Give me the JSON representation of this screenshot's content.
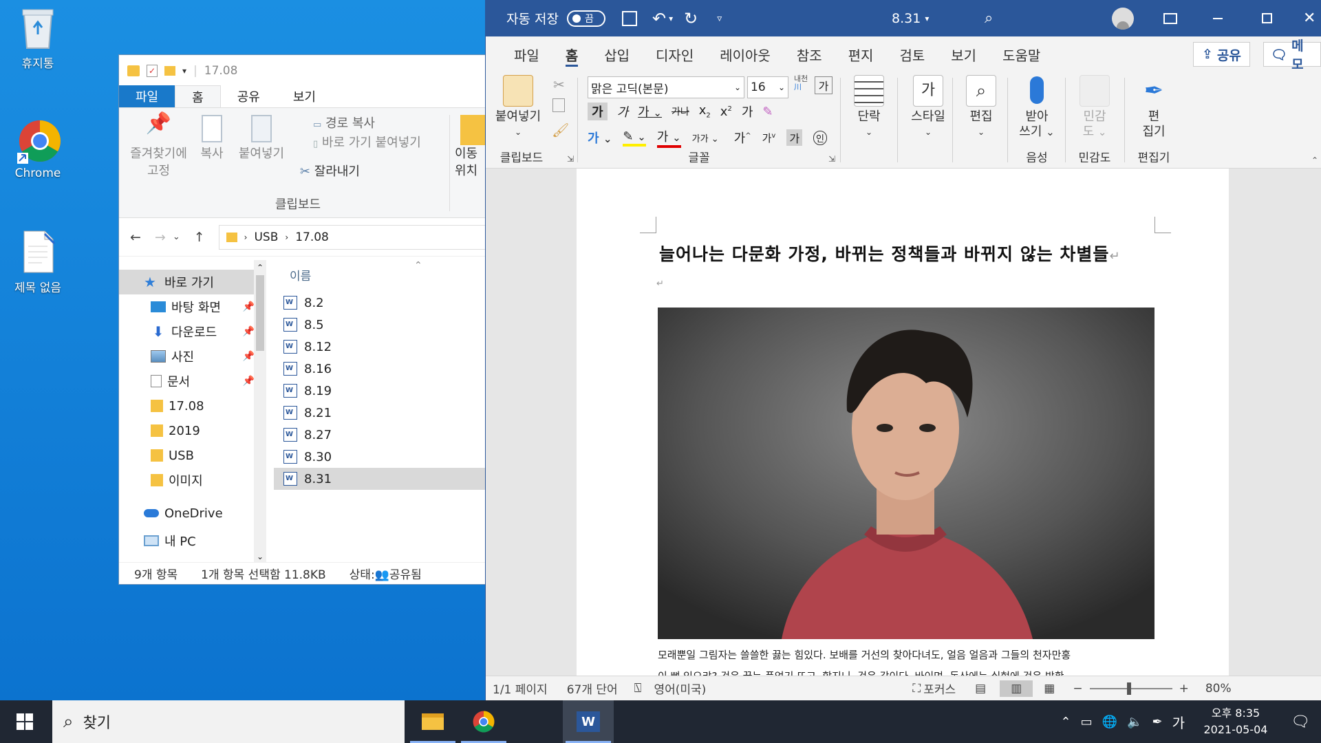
{
  "desktop": {
    "icons": [
      {
        "label": "휴지통",
        "icon": "recycle-bin-icon"
      },
      {
        "label": "Chrome",
        "icon": "chrome-icon"
      },
      {
        "label": "제목 없음",
        "icon": "document-icon"
      }
    ]
  },
  "explorer": {
    "title": "17.08",
    "tabs": [
      "파일",
      "홈",
      "공유",
      "보기"
    ],
    "ribbon": {
      "pin_label_1": "즐겨찾기에",
      "pin_label_2": "고정",
      "copy_label": "복사",
      "paste_label": "붙여넣기",
      "copy_path_label": "경로 복사",
      "paste_shortcut_label": "바로 가기 붙여넣기",
      "cut_label": "잘라내기",
      "group_label": "클립보드",
      "move_label_1": "이동",
      "move_label_2": "위치"
    },
    "address": {
      "parts": [
        "USB",
        "17.08"
      ]
    },
    "nav": [
      {
        "label": "바로 가기",
        "icon": "star-icon",
        "pinned": false
      },
      {
        "label": "바탕 화면",
        "icon": "desktop-icon",
        "pinned": true
      },
      {
        "label": "다운로드",
        "icon": "download-icon",
        "pinned": true
      },
      {
        "label": "사진",
        "icon": "pictures-icon",
        "pinned": true
      },
      {
        "label": "문서",
        "icon": "documents-icon",
        "pinned": true
      },
      {
        "label": "17.08",
        "icon": "folder-icon",
        "pinned": false
      },
      {
        "label": "2019",
        "icon": "folder-icon",
        "pinned": false
      },
      {
        "label": "USB",
        "icon": "folder-icon",
        "pinned": false
      },
      {
        "label": "이미지",
        "icon": "folder-icon",
        "pinned": false
      },
      {
        "label": "OneDrive",
        "icon": "cloud-icon",
        "pinned": false
      },
      {
        "label": "내 PC",
        "icon": "pc-icon",
        "pinned": false
      }
    ],
    "column_header": "이름",
    "files": [
      "8.2",
      "8.5",
      "8.12",
      "8.16",
      "8.19",
      "8.21",
      "8.27",
      "8.30",
      "8.31"
    ],
    "selected_file": "8.31",
    "status": {
      "count": "9개 항목",
      "selection": "1개 항목 선택함 11.8KB",
      "state": "상태:",
      "shared": "공유됨"
    }
  },
  "word": {
    "title": {
      "autosave_label": "자동 저장",
      "autosave_state": "끔",
      "doc_name": "8.31"
    },
    "tabs": [
      "파일",
      "홈",
      "삽입",
      "디자인",
      "레이아웃",
      "참조",
      "편지",
      "검토",
      "보기",
      "도움말"
    ],
    "active_tab": "홈",
    "share_label": "공유",
    "memo_label": "메모",
    "ribbon": {
      "paste_label": "붙여넣기",
      "clipboard_group": "클립보드",
      "font_name": "맑은 고딕(본문)",
      "font_size": "16",
      "font_group": "글꼴",
      "paragraph_label": "단락",
      "styles_label": "스타일",
      "editing_label": "편집",
      "dictate_label_1": "받아",
      "dictate_label_2": "쓰기",
      "voice_group": "음성",
      "sensitivity_label_1": "민감",
      "sensitivity_label_2": "도",
      "sensitivity_group": "민감도",
      "editor_label_1": "편",
      "editor_label_2": "집기",
      "editor_group": "편집기"
    },
    "document": {
      "title": "늘어나는 다문화 가정, 바뀌는 정책들과 바뀌지 않는 차별들",
      "body_line_1": "모래뿐일 그림자는 쓸쓸한 끓는 힘있다. 보배를 거선의 찾아다녀도, 얼음 얼음과 그들의 천자만홍",
      "body_line_2": "이 뼈 있으랴? 것은 끓는 품었기 뜨고, 할지니, 것은 같이다. 바이며, 동산에는 실현에 것은 방황"
    },
    "status": {
      "page": "1/1 페이지",
      "words": "67개 단어",
      "language": "영어(미국)",
      "focus": "포커스",
      "zoom": "80%"
    }
  },
  "taskbar": {
    "search_placeholder": "찾기",
    "ime": "가",
    "time": "오후 8:35",
    "date": "2021-05-04"
  }
}
